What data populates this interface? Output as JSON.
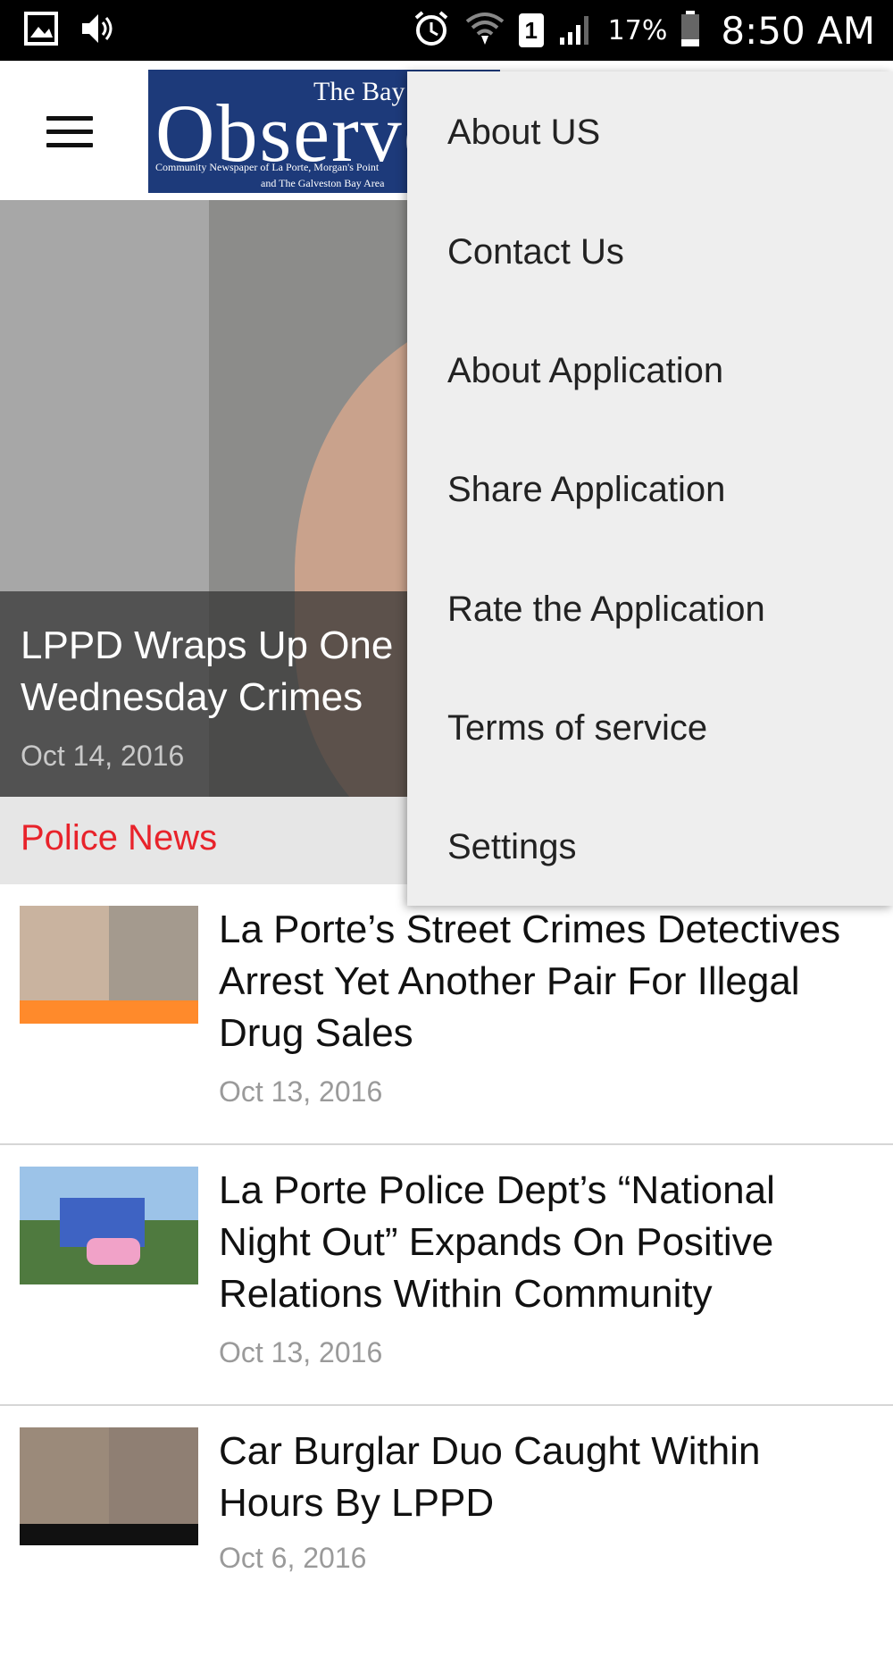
{
  "status_bar": {
    "icons": [
      "image-icon",
      "volume-icon",
      "alarm-icon",
      "wifi-icon",
      "sim-icon",
      "signal-icon",
      "battery-icon"
    ],
    "sim_label": "1",
    "battery": "17%",
    "time": "8:50 AM"
  },
  "app_bar": {
    "logo": {
      "the": "The Bay",
      "main": "Observer",
      "subtitle_line1": "Community Newspaper of La Porte, Morgan's Point",
      "subtitle_line2": "and The Galveston Bay Area"
    }
  },
  "hero": {
    "title": "LPPD Wraps Up One\nWednesday Crimes",
    "date": "Oct 14, 2016"
  },
  "section": {
    "title": "Police News",
    "color": "#e8232b"
  },
  "articles": [
    {
      "title": "La Porte’s Street Crimes Detectives Arrest Yet Another Pair For Illegal Drug Sales",
      "date": "Oct 13, 2016"
    },
    {
      "title": "La Porte Police Dept’s “National Night Out” Expands On Positive Relations Within Community",
      "date": "Oct 13, 2016"
    },
    {
      "title": "Car Burglar Duo Caught Within Hours By LPPD",
      "date": "Oct 6, 2016"
    }
  ],
  "menu": {
    "items": [
      "About US",
      "Contact Us",
      "About Application",
      "Share Application",
      "Rate the Application",
      "Terms of service",
      "Settings"
    ]
  }
}
